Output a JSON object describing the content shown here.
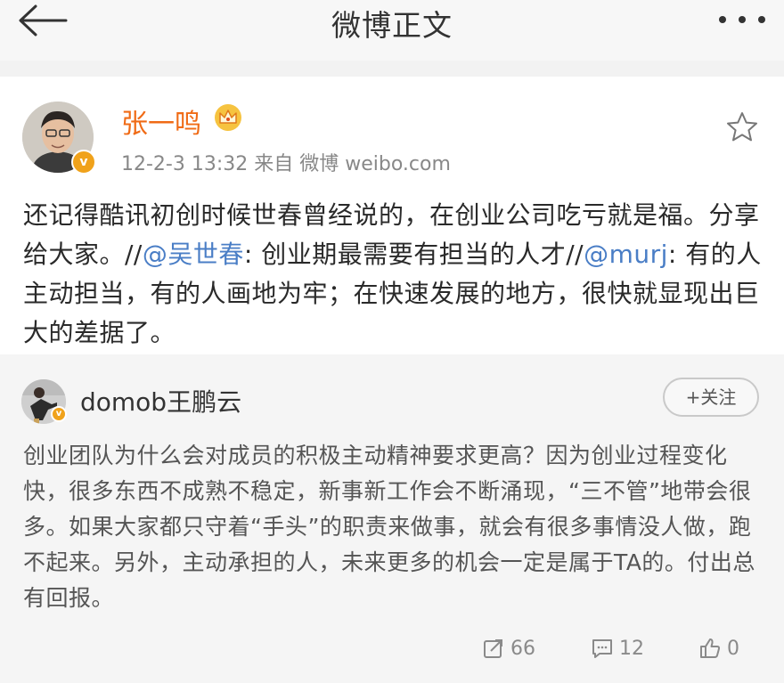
{
  "header": {
    "title": "微博正文",
    "back_icon": "back-arrow-icon",
    "more_icon": "more-dots-icon"
  },
  "post": {
    "author": "张一鸣",
    "crown_icon": "crown-icon",
    "meta": "12-2-3 13:32  来自 微博 weibo.com",
    "text": {
      "part1": "还记得酷讯初创时候世春曾经说的，在创业公司吃亏就是福。分享给大家。//",
      "mention1": "@吴世春",
      "part2": ": 创业期最需要有担当的人才//",
      "mention2": "@murj",
      "part3": ": 有的人主动担当，有的人画地为牢；在快速发展的地方，很快就显现出巨大的差据了。"
    }
  },
  "repost": {
    "author": "domob王鹏云",
    "follow_label": "+关注",
    "text": "创业团队为什么会对成员的积极主动精神要求更高？因为创业过程变化快，很多东西不成熟不稳定，新事新工作会不断涌现，“三不管”地带会很多。如果大家都只守着“手头”的职责来做事，就会有很多事情没人做，跑不起来。另外，主动承担的人，未来更多的机会一定是属于TA的。付出总有回报。",
    "stats": {
      "reposts": "66",
      "comments": "12",
      "likes": "0"
    }
  },
  "colors": {
    "author_orange": "#f06b16",
    "mention_blue": "#4a7ec6",
    "verified_badge": "#f0a21b"
  }
}
